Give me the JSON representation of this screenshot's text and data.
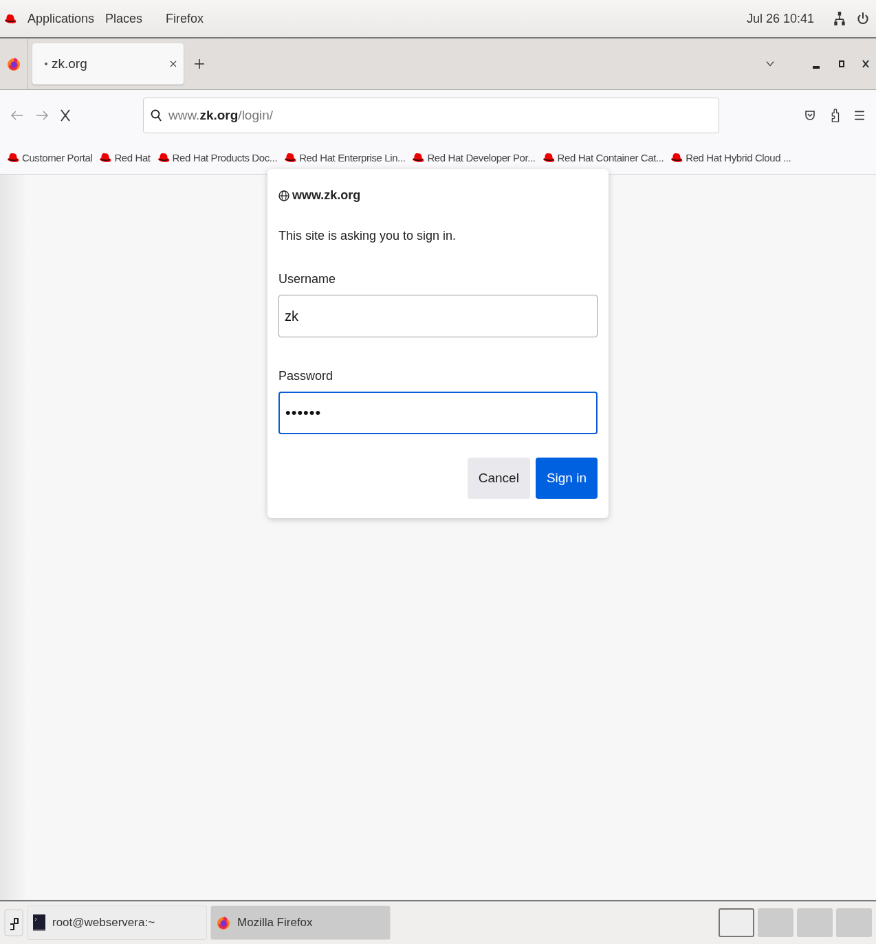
{
  "top_bar": {
    "menus": [
      "Applications",
      "Places",
      "Firefox"
    ],
    "clock": "Jul 26  10:41"
  },
  "tabs": [
    {
      "label": "zk.org",
      "selected": true,
      "loading": true
    }
  ],
  "address": {
    "prefix": "www.",
    "domain": "zk.org",
    "path": "/login/"
  },
  "bookmarks": [
    "Customer Portal",
    "Red Hat",
    "Red Hat Products Doc...",
    "Red Hat Enterprise Lin...",
    "Red Hat Developer Por...",
    "Red Hat Container Cat...",
    "Red Hat Hybrid Cloud ..."
  ],
  "dialog": {
    "site": "www.zk.org",
    "message": "This site is asking you to sign in.",
    "fields": [
      {
        "label": "Username",
        "value": "zk",
        "focused": false
      },
      {
        "label": "Password",
        "value": "••••••",
        "focused": true
      }
    ],
    "buttons": [
      {
        "label": "Cancel",
        "kind": "secondary"
      },
      {
        "label": "Sign in",
        "kind": "primary"
      }
    ]
  },
  "taskbar": {
    "windows": [
      {
        "label": "root@webservera:~",
        "kind": "terminal",
        "selected": false
      },
      {
        "label": "Mozilla Firefox",
        "kind": "browser",
        "selected": true
      }
    ],
    "workspaces": [
      {
        "selected": true
      },
      {
        "selected": false
      },
      {
        "selected": false
      },
      {
        "selected": false
      }
    ]
  }
}
